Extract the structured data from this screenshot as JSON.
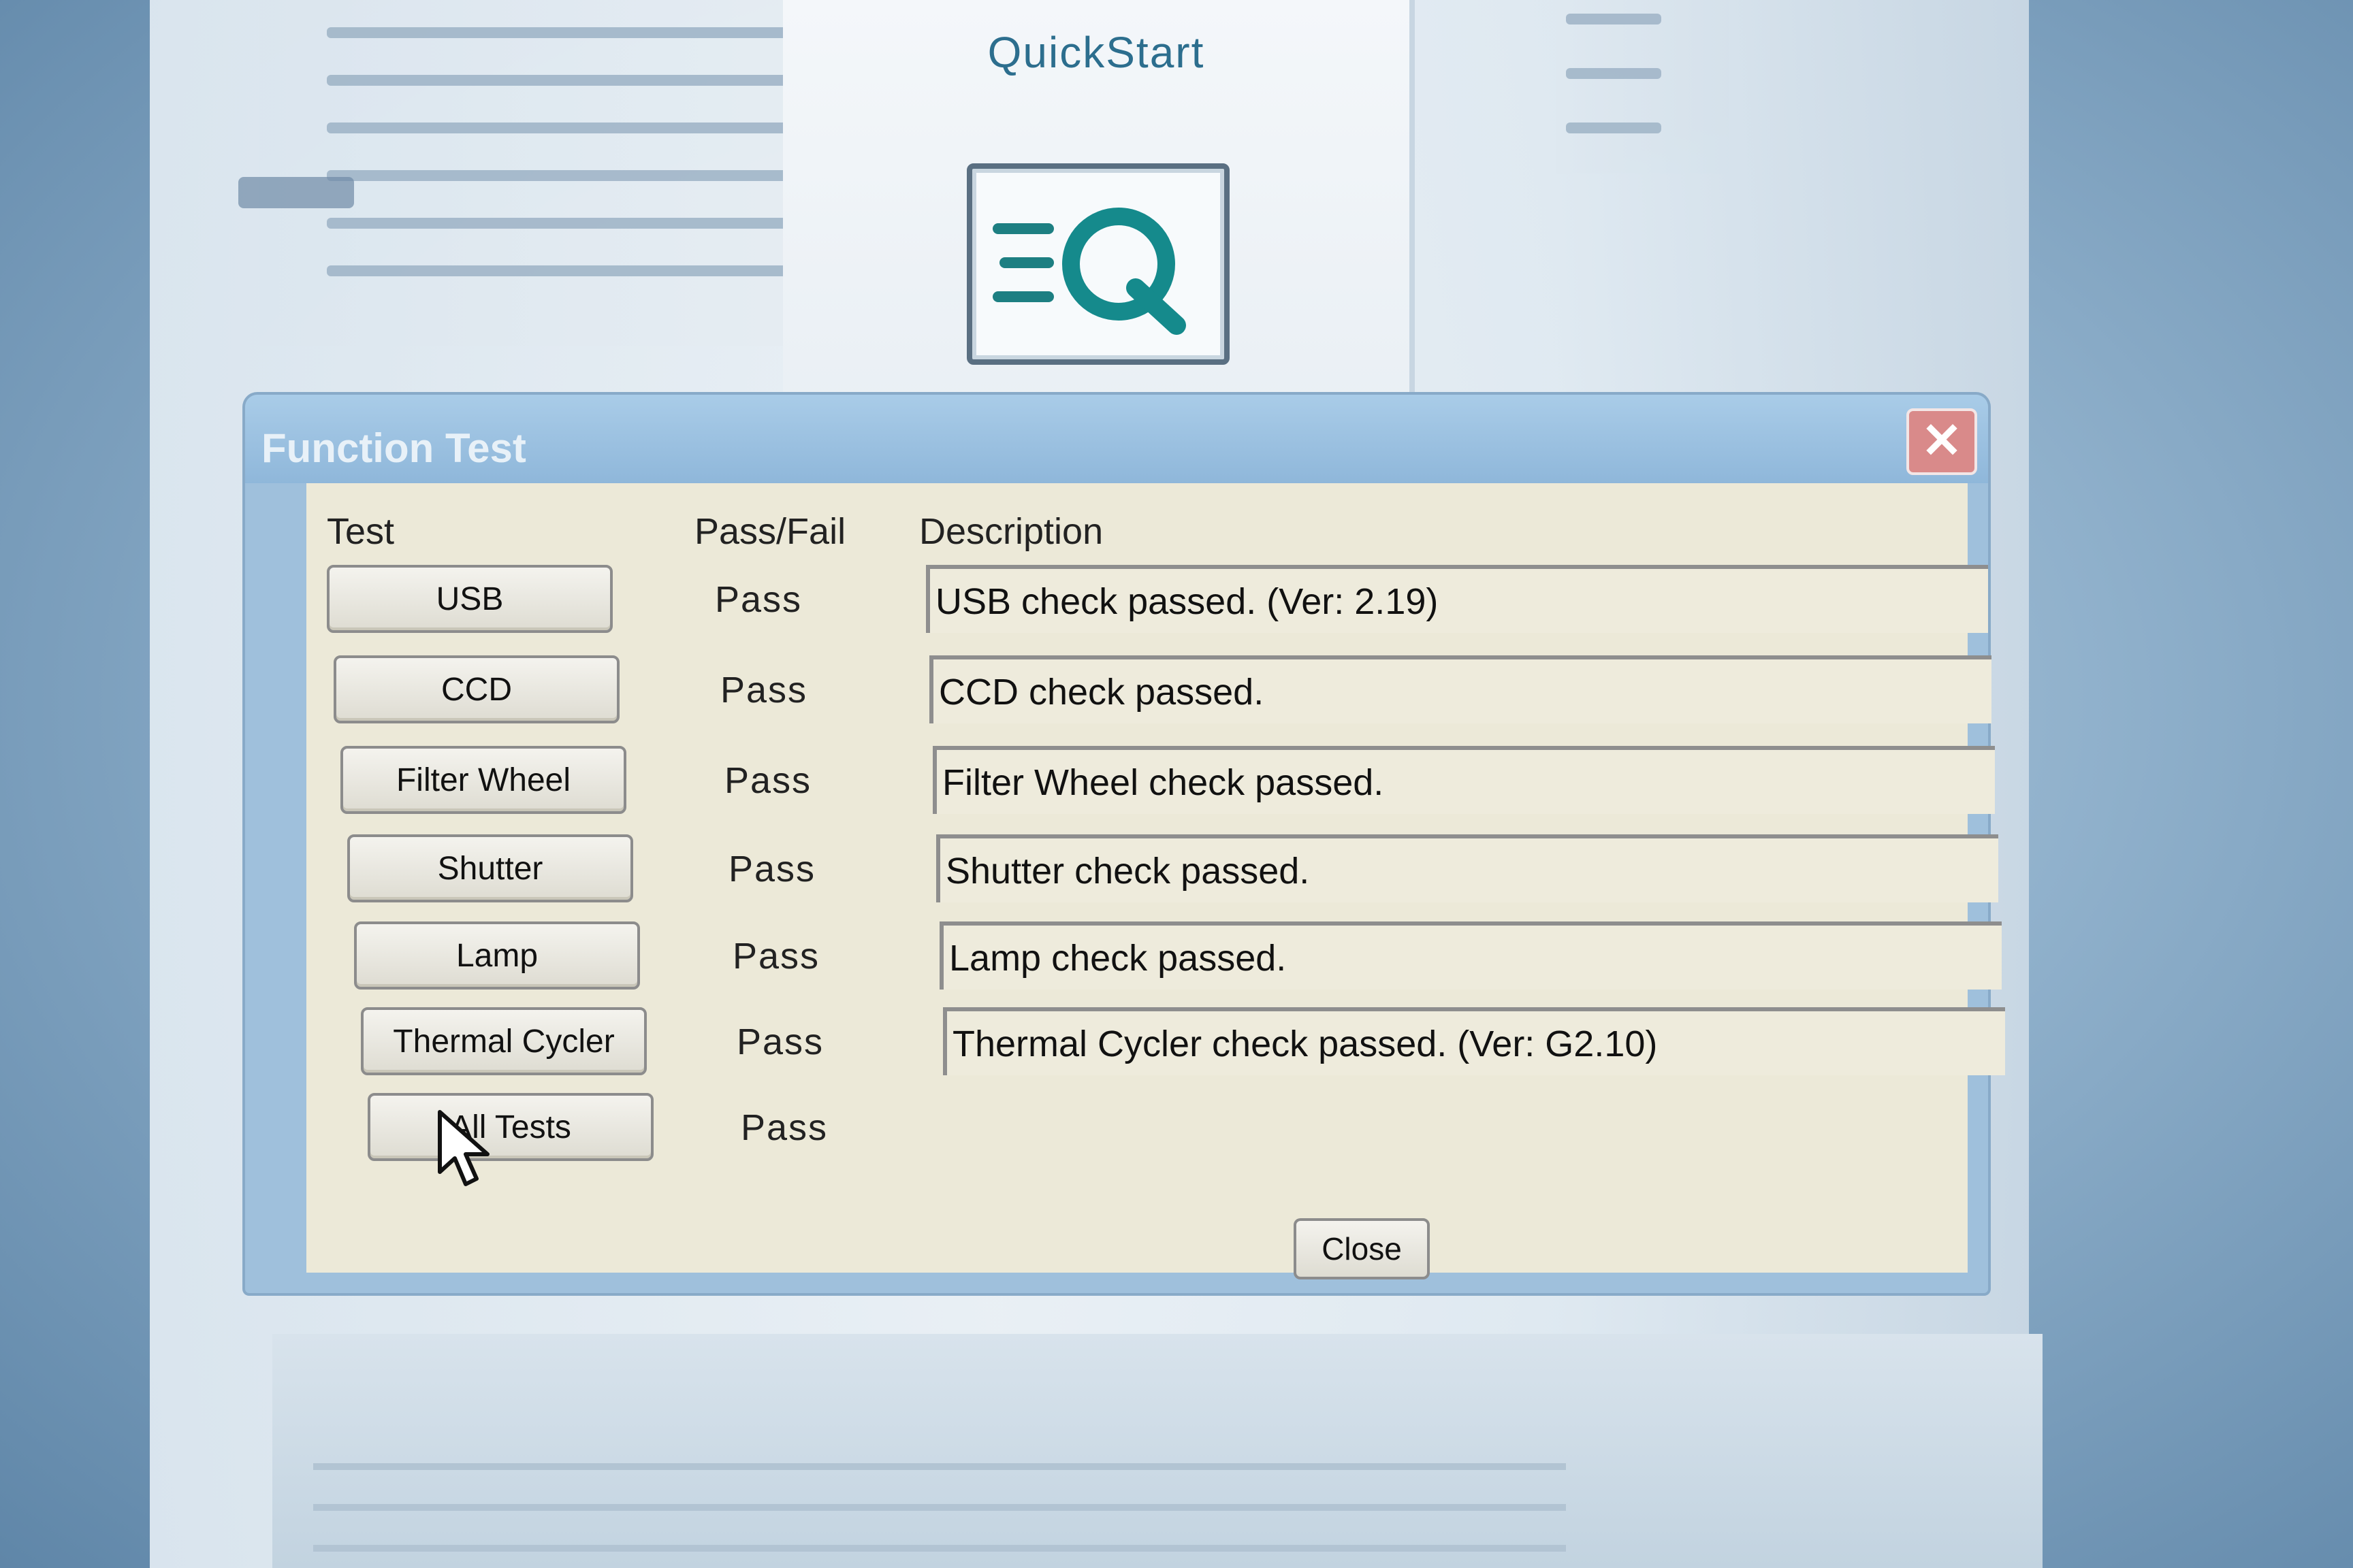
{
  "quickstart": {
    "title": "QuickStart",
    "icon": "eq-logo-icon"
  },
  "dialog": {
    "title": "Function Test",
    "close_x_icon": "close-icon",
    "headers": {
      "test": "Test",
      "pass_fail": "Pass/Fail",
      "description": "Description"
    },
    "rows": [
      {
        "test": "USB",
        "result": "Pass",
        "description": "USB check passed. (Ver: 2.19)"
      },
      {
        "test": "CCD",
        "result": "Pass",
        "description": "CCD check passed."
      },
      {
        "test": "Filter Wheel",
        "result": "Pass",
        "description": "Filter Wheel check passed."
      },
      {
        "test": "Shutter",
        "result": "Pass",
        "description": "Shutter check passed."
      },
      {
        "test": "Lamp",
        "result": "Pass",
        "description": "Lamp check passed."
      },
      {
        "test": "Thermal Cycler",
        "result": "Pass",
        "description": "Thermal Cycler check passed. (Ver: G2.10)"
      },
      {
        "test": "All Tests",
        "result": "Pass",
        "description": ""
      }
    ],
    "close_label": "Close"
  },
  "cursor": "mouse-pointer-icon",
  "colors": {
    "titlebar": "#8fb7da",
    "dialog_body": "#ece9d8",
    "accent_teal": "#1d8a8a",
    "close_x": "#d98a8a"
  }
}
